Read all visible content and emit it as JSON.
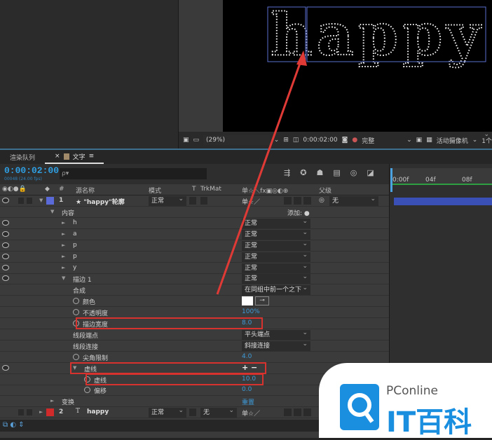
{
  "viewer": {
    "text": "happy",
    "zoom": "(29%)",
    "timecode": "0:00:02:00",
    "quality": "完整",
    "camera": "活动摄像机",
    "views": "1个"
  },
  "tabs": [
    {
      "label": "渲染队列"
    },
    {
      "label": "文字"
    }
  ],
  "timeline": {
    "timecode": "0:00:02:00",
    "fps": "00048 (24.00 fps)",
    "search_placeholder": "ρ▾",
    "ruler": [
      "0:00f",
      "04f",
      "08f"
    ]
  },
  "columns": {
    "name": "源名称",
    "mode": "模式",
    "t": "T",
    "trkmat": "TrkMat",
    "switches": "单☆＼fx▣◎◐⊕",
    "parent": "父级",
    "number": "#"
  },
  "layers": [
    {
      "num": "1",
      "name": "★ \"happy\"轮廓",
      "mode": "正常",
      "parent": "无",
      "color": "#5a6ad8"
    },
    {
      "num": "2",
      "name": "happy",
      "mode": "正常",
      "trkmat": "无",
      "color": "#d02a2a"
    }
  ],
  "rows": [
    {
      "label": "内容",
      "indent": 1,
      "twirl": "down",
      "extra": "添加: ●"
    },
    {
      "label": "h",
      "indent": 2,
      "twirl": "right",
      "eye": true,
      "dropdown": "正常"
    },
    {
      "label": "a",
      "indent": 2,
      "twirl": "right",
      "eye": true,
      "dropdown": "正常"
    },
    {
      "label": "p",
      "indent": 2,
      "twirl": "right",
      "eye": true,
      "dropdown": "正常"
    },
    {
      "label": "p",
      "indent": 2,
      "twirl": "right",
      "eye": true,
      "dropdown": "正常"
    },
    {
      "label": "y",
      "indent": 2,
      "twirl": "right",
      "eye": true,
      "dropdown": "正常"
    },
    {
      "label": "描边 1",
      "indent": 2,
      "twirl": "down",
      "eye": true,
      "dropdown": "正常"
    },
    {
      "label": "合成",
      "indent": 3,
      "dropdown": "在同组中前一个之下"
    },
    {
      "label": "颜色",
      "indent": 3,
      "stopwatch": true,
      "color": "#ffffff"
    },
    {
      "label": "不透明度",
      "indent": 3,
      "stopwatch": true,
      "number": "100%"
    },
    {
      "label": "描边宽度",
      "indent": 3,
      "stopwatch": true,
      "number": "8.0",
      "highlighted": true
    },
    {
      "label": "线段端点",
      "indent": 3,
      "dropdown": "平头端点"
    },
    {
      "label": "线段连接",
      "indent": 3,
      "dropdown": "斜接连接"
    },
    {
      "label": "尖角限制",
      "indent": 3,
      "stopwatch": true,
      "number": "4.0"
    },
    {
      "label": "虚线",
      "indent": 3,
      "twirl": "down",
      "eye": true,
      "plusminus": "+ −",
      "highlighted": true
    },
    {
      "label": "虚线",
      "indent": 4,
      "stopwatch": true,
      "number": "10.0",
      "highlighted": true
    },
    {
      "label": "偏移",
      "indent": 4,
      "stopwatch": true,
      "number": "0.0"
    },
    {
      "label": "变换",
      "indent": 1,
      "twirl": "right",
      "number": "重置"
    }
  ],
  "watermark": {
    "brand": "PConline",
    "name": "IT百科"
  },
  "colors": {
    "accent": "#2f9fe3",
    "highlight": "#d8322f",
    "arrow": "#e03a36"
  }
}
